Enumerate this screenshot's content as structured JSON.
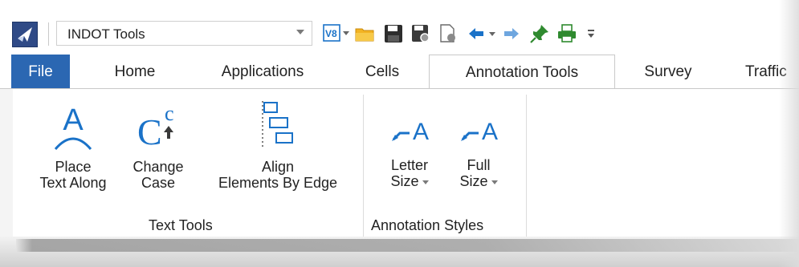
{
  "qat": {
    "workspace_value": "INDOT Tools",
    "icons": [
      "app-logo-icon",
      "v8-icon",
      "open-folder-icon",
      "save-icon",
      "save-settings-icon",
      "properties-icon",
      "undo-icon",
      "redo-icon",
      "pin-icon",
      "print-icon",
      "customize-qat-icon"
    ]
  },
  "tabs": [
    {
      "label": "File"
    },
    {
      "label": "Home"
    },
    {
      "label": "Applications"
    },
    {
      "label": "Cells"
    },
    {
      "label": "Annotation Tools"
    },
    {
      "label": "Survey"
    },
    {
      "label": "Traffic"
    }
  ],
  "active_tab": "Annotation Tools",
  "groups": {
    "text_tools": {
      "label": "Text Tools",
      "buttons": [
        {
          "line1": "Place",
          "line2": "Text Along",
          "icon": "place-text-along-icon"
        },
        {
          "line1": "Change",
          "line2": "Case",
          "icon": "change-case-icon"
        },
        {
          "line1": "Align",
          "line2": "Elements By Edge",
          "icon": "align-elements-icon"
        }
      ]
    },
    "annotation_styles": {
      "label": "Annotation Styles",
      "buttons": [
        {
          "line1": "Letter",
          "line2": "Size",
          "icon": "letter-size-icon"
        },
        {
          "line1": "Full",
          "line2": "Size",
          "icon": "full-size-icon"
        }
      ]
    }
  },
  "colors": {
    "file_tab": "#2b67b2",
    "icon_blue": "#1a72c8",
    "folder_yellow": "#f2b323",
    "pin_green": "#2f8a2f"
  }
}
